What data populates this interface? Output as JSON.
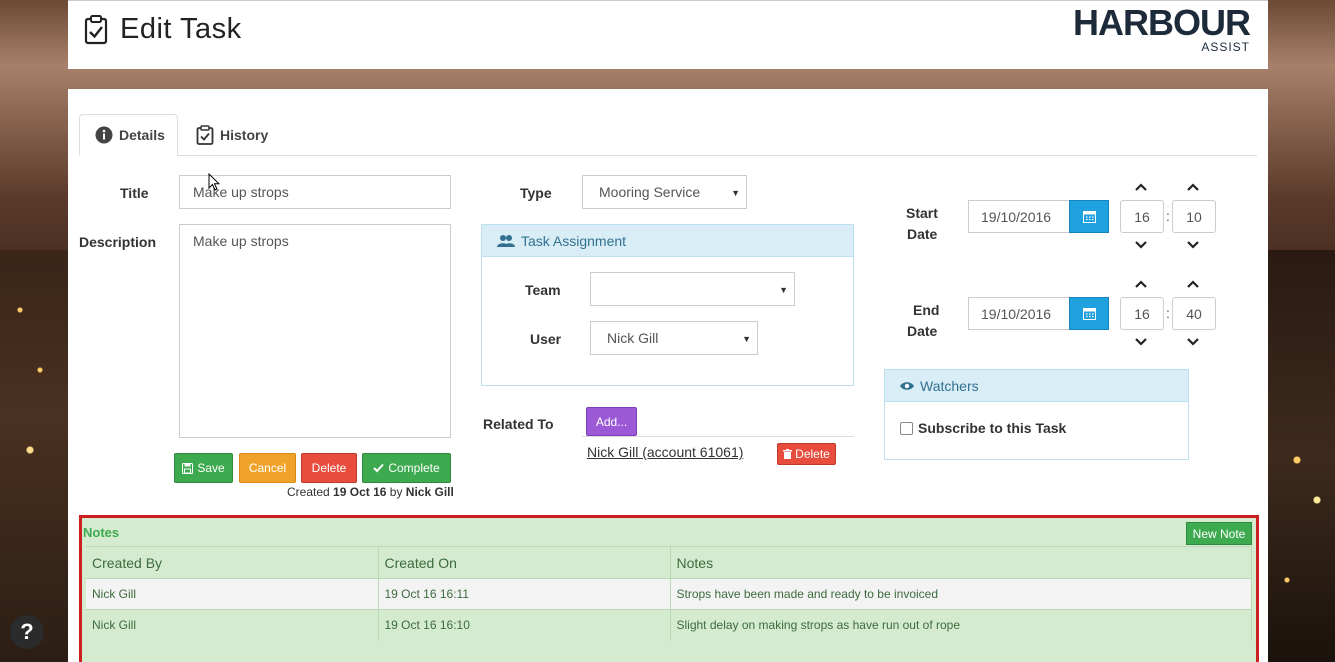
{
  "header": {
    "title": "Edit Task",
    "logo_brand": "HARBOUR",
    "logo_sub": "ASSIST"
  },
  "tabs": [
    {
      "label": "Details"
    },
    {
      "label": "History"
    }
  ],
  "form": {
    "title_label": "Title",
    "title_value": "Make up strops",
    "description_label": "Description",
    "description_value": "Make up strops",
    "type_label": "Type",
    "type_value": "Mooring Service"
  },
  "assignment": {
    "heading": "Task Assignment",
    "team_label": "Team",
    "team_value": "",
    "user_label": "User",
    "user_value": "Nick Gill"
  },
  "related": {
    "label": "Related To",
    "add_label": "Add...",
    "link_text": "Nick Gill (account 61061)",
    "delete_label": "Delete"
  },
  "dates": {
    "start_label_1": "Start",
    "start_label_2": "Date",
    "start_date": "19/10/2016",
    "start_hour": "16",
    "start_min": "10",
    "end_label_1": "End",
    "end_label_2": "Date",
    "end_date": "19/10/2016",
    "end_hour": "16",
    "end_min": "40",
    "colon": ":"
  },
  "watchers": {
    "heading": "Watchers",
    "subscribe_label": "Subscribe to this Task"
  },
  "actions": {
    "save": "Save",
    "cancel": "Cancel",
    "delete": "Delete",
    "complete": "Complete"
  },
  "created": {
    "prefix": "Created",
    "date": "19 Oct 16",
    "by": "by",
    "user": "Nick Gill"
  },
  "notes": {
    "title": "Notes",
    "new_note": "New Note",
    "columns": [
      "Created By",
      "Created On",
      "Notes"
    ],
    "rows": [
      {
        "by": "Nick Gill",
        "on": "19 Oct 16 16:11",
        "text": "Strops have been made and ready to be invoiced"
      },
      {
        "by": "Nick Gill",
        "on": "19 Oct 16 16:10",
        "text": "Slight delay on making strops as have run out of rope"
      }
    ]
  },
  "help": "?"
}
